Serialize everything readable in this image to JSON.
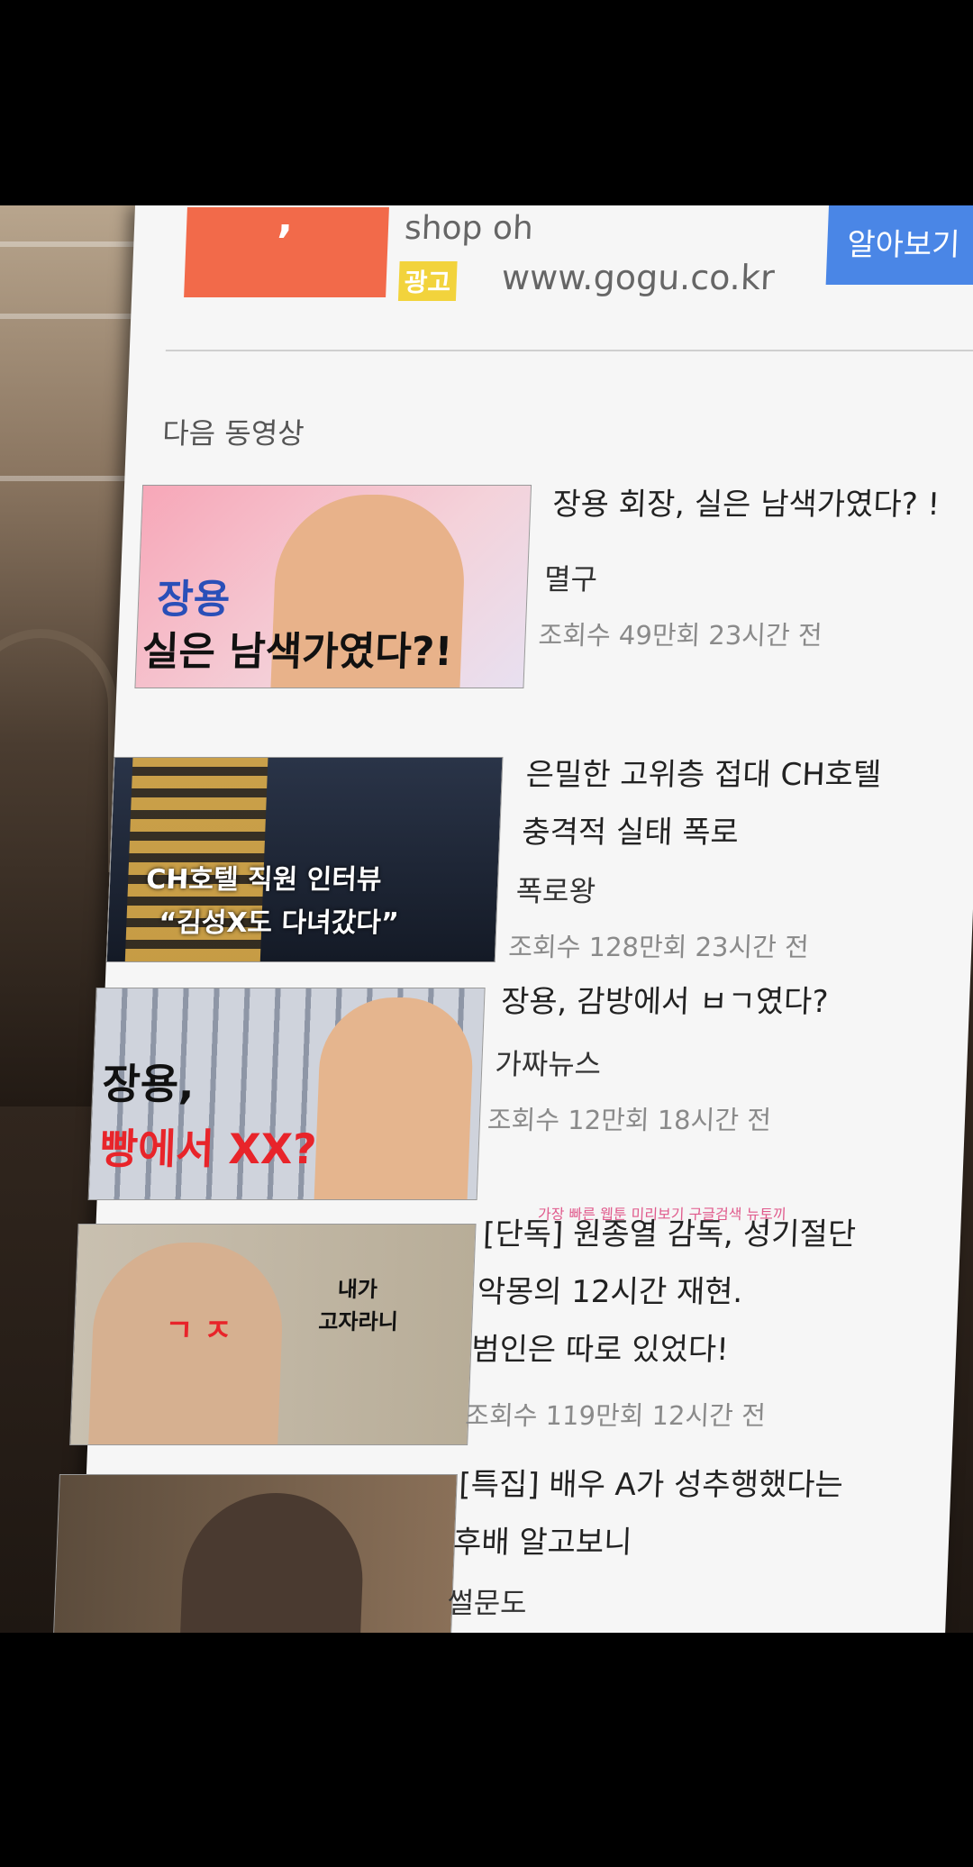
{
  "ad": {
    "logo_char": "’",
    "title": "shop oh",
    "badge": "광고",
    "url": "www.gogu.co.kr",
    "button": "알아보기"
  },
  "section_title": "다음 동영상",
  "videos": [
    {
      "thumb_lines": [
        "장용",
        "실은 남색가였다?!"
      ],
      "title_lines": [
        "장용 회장, 실은 남색가였다? !"
      ],
      "source": "멸구",
      "meta": "조회수 49만회  23시간 전"
    },
    {
      "thumb_lines": [
        "CH호텔 직원 인터뷰",
        "“김성X도 다녀갔다”"
      ],
      "title_lines": [
        "은밀한 고위층 접대 CH호텔",
        "충격적 실태 폭로"
      ],
      "source": "폭로왕",
      "meta": "조회수 128만회  23시간 전"
    },
    {
      "thumb_lines": [
        "장용,",
        "빵에서 XX?"
      ],
      "title_lines": [
        "장용, 감방에서 ㅂㄱ였다?"
      ],
      "source": "가짜뉴스",
      "meta": "조회수 12만회  18시간 전"
    },
    {
      "thumb_lines": [
        "ㄱ  ㅈ",
        "내가",
        "고자라니"
      ],
      "title_lines": [
        "[단독] 원종열 감독, 성기절단",
        "악몽의 12시간 재현.",
        "범인은 따로 있었다!"
      ],
      "source": "",
      "meta": "조회수 119만회  12시간 전"
    },
    {
      "thumb_lines": [],
      "title_lines": [
        "[특집] 배우 A가 성추행했다는",
        "후배 알고보니"
      ],
      "source": "썰문도",
      "meta": ""
    }
  ],
  "watermark": "가장 빠른 웹툰 미리보기 구글검색 뉴토끼",
  "colors": {
    "ad_orange": "#f26a4a",
    "ad_badge": "#f2d33c",
    "button_blue": "#4a86e6",
    "highlight_red": "#e8242a"
  }
}
